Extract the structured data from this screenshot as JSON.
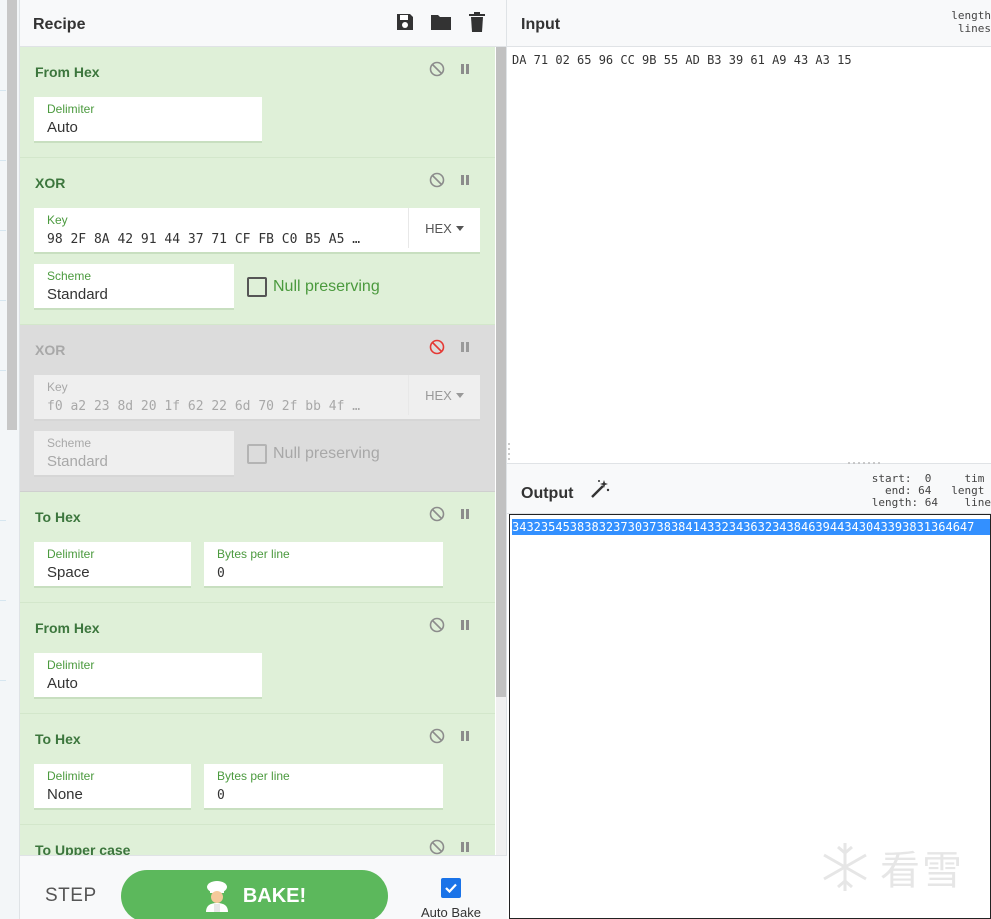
{
  "recipe": {
    "title": "Recipe",
    "operations": [
      {
        "name": "From Hex",
        "fields": [
          {
            "label": "Delimiter",
            "value": "Auto"
          }
        ]
      },
      {
        "name": "XOR",
        "key_label": "Key",
        "key_value": "98 2F 8A 42 91 44 37 71 CF FB C0 B5 A5 …",
        "key_format": "HEX",
        "scheme_label": "Scheme",
        "scheme_value": "Standard",
        "null_preserving": "Null preserving"
      },
      {
        "name": "XOR",
        "disabled": true,
        "key_label": "Key",
        "key_value": "f0 a2 23 8d 20 1f 62 22 6d 70 2f bb 4f …",
        "key_format": "HEX",
        "scheme_label": "Scheme",
        "scheme_value": "Standard",
        "null_preserving": "Null preserving"
      },
      {
        "name": "To Hex",
        "fields": [
          {
            "label": "Delimiter",
            "value": "Space"
          },
          {
            "label": "Bytes per line",
            "value": "0"
          }
        ]
      },
      {
        "name": "From Hex",
        "fields": [
          {
            "label": "Delimiter",
            "value": "Auto"
          }
        ]
      },
      {
        "name": "To Hex",
        "fields": [
          {
            "label": "Delimiter",
            "value": "None"
          },
          {
            "label": "Bytes per line",
            "value": "0"
          }
        ]
      },
      {
        "name": "To Upper case"
      }
    ]
  },
  "controls": {
    "step_label": "STEP",
    "bake_label": "BAKE!",
    "autobake_label": "Auto Bake"
  },
  "input": {
    "title": "Input",
    "stats": "length\n lines",
    "text": "DA 71 02 65 96 CC 9B 55 AD B3 39 61 A9 43 A3 15"
  },
  "output": {
    "title": "Output",
    "stats": "start:  0     tim\n  end: 64   lengt\nlength: 64    line",
    "text": "3432354538383237303738384143323436323438463944343043393831364647"
  },
  "watermark": "看雪",
  "colors": {
    "op_bg": "#dff0d8",
    "op_disabled_bg": "#dcdcdc",
    "op_title": "#3c763d",
    "bake_green": "#5cb85c",
    "selection_blue": "#3390ff",
    "disable_red": "#e53935"
  },
  "icons": {
    "save": "save-icon",
    "open": "folder-icon",
    "clear": "trash-icon",
    "disable": "ban-icon",
    "breakpoint": "pause-icon",
    "magic": "magic-wand-icon",
    "chef": "chef-icon"
  }
}
